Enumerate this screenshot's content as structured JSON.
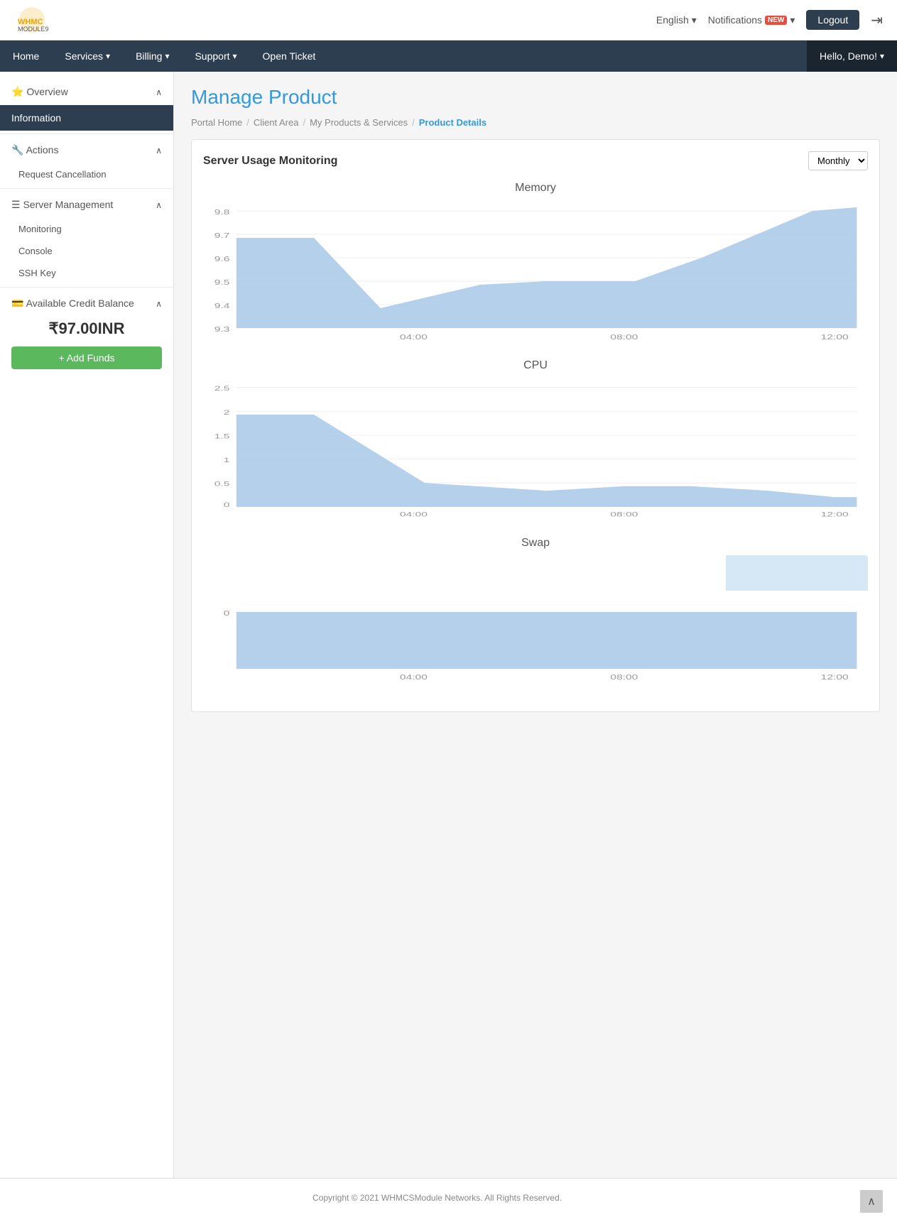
{
  "topbar": {
    "logo_alt": "WHMCS Module9",
    "language": "English",
    "notifications_label": "Notifications",
    "notifications_badge": "NEW",
    "logout_label": "Logout"
  },
  "navbar": {
    "items": [
      {
        "label": "Home",
        "id": "home"
      },
      {
        "label": "Services",
        "id": "services",
        "has_dropdown": true
      },
      {
        "label": "Billing",
        "id": "billing",
        "has_dropdown": true
      },
      {
        "label": "Support",
        "id": "support",
        "has_dropdown": true
      },
      {
        "label": "Open Ticket",
        "id": "open-ticket"
      }
    ],
    "user_greeting": "Hello, Demo!"
  },
  "sidebar": {
    "overview_label": "Overview",
    "information_label": "Information",
    "actions_label": "Actions",
    "actions_items": [
      {
        "label": "Request Cancellation",
        "id": "request-cancellation"
      }
    ],
    "server_management_label": "Server Management",
    "server_management_items": [
      {
        "label": "Monitoring",
        "id": "monitoring"
      },
      {
        "label": "Console",
        "id": "console"
      },
      {
        "label": "SSH Key",
        "id": "ssh-key"
      }
    ],
    "credit_balance_label": "Available Credit Balance",
    "credit_amount": "₹97.00INR",
    "add_funds_label": "+ Add Funds"
  },
  "content": {
    "page_title": "Manage Product",
    "breadcrumb": [
      {
        "label": "Portal Home",
        "id": "portal-home"
      },
      {
        "label": "Client Area",
        "id": "client-area"
      },
      {
        "label": "My Products & Services",
        "id": "my-products"
      },
      {
        "label": "Product Details",
        "id": "product-details",
        "active": true
      }
    ],
    "chart_panel_title": "Server Usage Monitoring",
    "monthly_label": "Monthly",
    "charts": [
      {
        "title": "Memory",
        "id": "memory",
        "y_labels": [
          "9.8",
          "9.7",
          "9.6",
          "9.5",
          "9.4",
          "9.3"
        ],
        "x_labels": [
          "04:00",
          "08:00",
          "12:00"
        ]
      },
      {
        "title": "CPU",
        "id": "cpu",
        "y_labels": [
          "2.5",
          "2",
          "1.5",
          "1",
          "0.5",
          "0"
        ],
        "x_labels": [
          "04:00",
          "08:00",
          "12:00"
        ]
      },
      {
        "title": "Swap",
        "id": "swap",
        "y_labels": [
          "0"
        ],
        "x_labels": [
          "04:00",
          "08:00",
          "12:00"
        ]
      }
    ]
  },
  "footer": {
    "copyright": "Copyright © 2021 WHMCSModule Networks. All Rights Reserved."
  }
}
